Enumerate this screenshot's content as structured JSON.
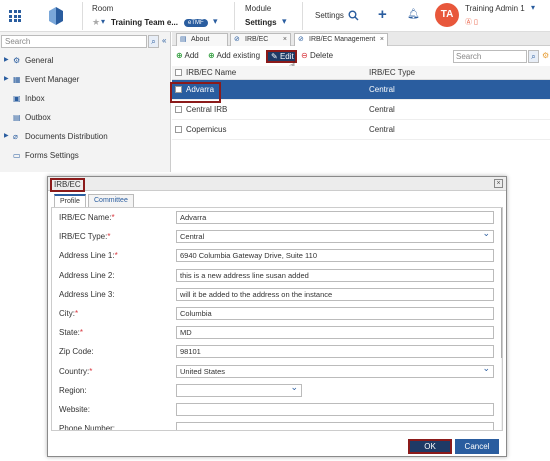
{
  "header": {
    "room_label": "Room",
    "room_value": "Training Team e...",
    "room_badge": "eTMF",
    "module_label": "Module",
    "module_value": "Settings",
    "settings_label": "Settings",
    "avatar_initials": "TA",
    "user_name": "Training Admin 1",
    "brand_color": "#2a5d9f",
    "avatar_color": "#e8573b"
  },
  "sidebar": {
    "search_placeholder": "Search",
    "items": [
      {
        "label": "General",
        "icon": "wrench-icon"
      },
      {
        "label": "Event Manager",
        "icon": "calendar-icon"
      },
      {
        "label": "Inbox",
        "icon": "inbox-icon"
      },
      {
        "label": "Outbox",
        "icon": "outbox-icon"
      },
      {
        "label": "Documents Distribution",
        "icon": "paperclip-icon"
      },
      {
        "label": "Forms Settings",
        "icon": "form-icon"
      }
    ]
  },
  "tabs": [
    {
      "label": "About"
    },
    {
      "label": "IRB/EC"
    },
    {
      "label": "IRB/EC Management"
    }
  ],
  "toolbar": {
    "add_label": "Add",
    "add_existing_label": "Add existing",
    "edit_label": "Edit",
    "delete_label": "Delete",
    "search_placeholder": "Search"
  },
  "table": {
    "headers": [
      "IRB/EC Name",
      "IRB/EC Type"
    ],
    "rows": [
      {
        "name": "Advarra",
        "type": "Central"
      },
      {
        "name": "Central IRB",
        "type": "Central"
      },
      {
        "name": "Copernicus",
        "type": "Central"
      }
    ]
  },
  "dialog": {
    "title": "IRB/EC",
    "tabs": [
      "Profile",
      "Committee"
    ],
    "fields": [
      {
        "label": "IRB/EC Name:",
        "required": "*",
        "value": "Advarra"
      },
      {
        "label": "IRB/EC Type:",
        "required": "*",
        "value": "Central"
      },
      {
        "label": "Address Line 1:",
        "required": "*",
        "value": "6940 Columbia Gateway Drive, Suite 110"
      },
      {
        "label": "Address Line 2:",
        "required": "",
        "value": "this is a new address line susan added"
      },
      {
        "label": "Address Line 3:",
        "required": "",
        "value": "will it be added to the address on the instance"
      },
      {
        "label": "City:",
        "required": "*",
        "value": "Columbia"
      },
      {
        "label": "State:",
        "required": "*",
        "value": "MD"
      },
      {
        "label": "Zip Code:",
        "required": "",
        "value": "98101"
      },
      {
        "label": "Country:",
        "required": "*",
        "value": "United States"
      },
      {
        "label": "Region:",
        "required": "",
        "value": ""
      },
      {
        "label": "Website:",
        "required": "",
        "value": ""
      },
      {
        "label": "Phone Number:",
        "required": "",
        "value": ""
      }
    ],
    "ok_label": "OK",
    "cancel_label": "Cancel"
  }
}
